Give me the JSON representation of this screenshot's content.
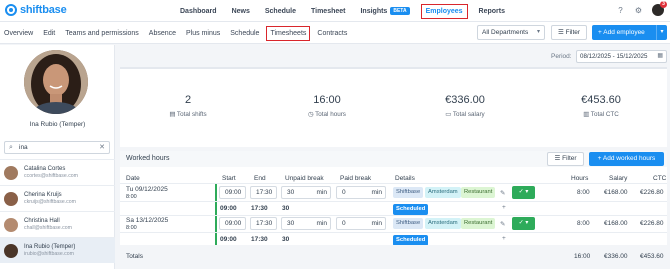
{
  "app": {
    "logo_text": "shiftbase",
    "brand_color": "#1a8ef0",
    "badge_count": "3"
  },
  "topnav": {
    "items": [
      {
        "label": "Dashboard"
      },
      {
        "label": "News"
      },
      {
        "label": "Schedule"
      },
      {
        "label": "Timesheet"
      },
      {
        "label": "Insights",
        "badge": "BETA"
      },
      {
        "label": "Employees"
      },
      {
        "label": "Reports"
      }
    ],
    "active": "Employees"
  },
  "subnav": {
    "tabs": [
      {
        "label": "Overview"
      },
      {
        "label": "Edit"
      },
      {
        "label": "Teams and permissions"
      },
      {
        "label": "Absence"
      },
      {
        "label": "Plus minus"
      },
      {
        "label": "Schedule"
      },
      {
        "label": "Timesheets"
      },
      {
        "label": "Contracts"
      }
    ],
    "active": "Timesheets",
    "department_select": "All Departments",
    "filter_label": "Filter",
    "add_employee_label": "+ Add employee"
  },
  "sidebar": {
    "profile_name": "Ina Rubio (Temper)",
    "search_value": "ina",
    "employees": [
      {
        "name": "Catalina Cortes",
        "email": "ccortes@shiftbase.com"
      },
      {
        "name": "Cherina Kruijs",
        "email": "ckruijs@shiftbase.com"
      },
      {
        "name": "Christina Hall",
        "email": "chall@shiftbase.com"
      },
      {
        "name": "Ina Rubio (Temper)",
        "email": "irubio@shiftbase.com"
      }
    ]
  },
  "period": {
    "label": "Period:",
    "value": "08/12/2025 - 15/12/2025"
  },
  "stats": [
    {
      "value": "2",
      "label": "Total shifts",
      "icon": "shifts-icon"
    },
    {
      "value": "16:00",
      "label": "Total hours",
      "icon": "clock-icon"
    },
    {
      "value": "€336.00",
      "label": "Total salary",
      "icon": "salary-icon"
    },
    {
      "value": "€453.60",
      "label": "Total CTC",
      "icon": "ctc-icon"
    }
  ],
  "worked_hours": {
    "title": "Worked hours",
    "filter_label": "Filter",
    "add_label": "+ Add worked hours",
    "columns": [
      "Date",
      "Start",
      "End",
      "Unpaid break",
      "Paid break",
      "Details",
      "Hours",
      "Salary",
      "CTC"
    ],
    "rows": [
      {
        "date": "Tu 09/12/2025",
        "date_sub": "8:00",
        "start": "09:00",
        "end": "17:30",
        "unpaid": "30",
        "unpaid_unit": "min",
        "paid": "0",
        "paid_unit": "min",
        "shift": "Shiftbase",
        "location": "Amsterdam",
        "department": "Restaurant",
        "hours": "8:00",
        "salary": "€168.00",
        "ctc": "€226.80",
        "sched_start": "09:00",
        "sched_end": "17:30",
        "sched_break": "30",
        "sched_tag": "Scheduled"
      },
      {
        "date": "Sa 13/12/2025",
        "date_sub": "8:00",
        "start": "09:00",
        "end": "17:30",
        "unpaid": "30",
        "unpaid_unit": "min",
        "paid": "0",
        "paid_unit": "min",
        "shift": "Shiftbase",
        "location": "Amsterdam",
        "department": "Restaurant",
        "hours": "8:00",
        "salary": "€168.00",
        "ctc": "€226.80",
        "sched_start": "09:00",
        "sched_end": "17:30",
        "sched_break": "30",
        "sched_tag": "Scheduled"
      }
    ],
    "totals": {
      "label": "Totals",
      "hours": "16:00",
      "salary": "€336.00",
      "ctc": "€453.60"
    }
  }
}
